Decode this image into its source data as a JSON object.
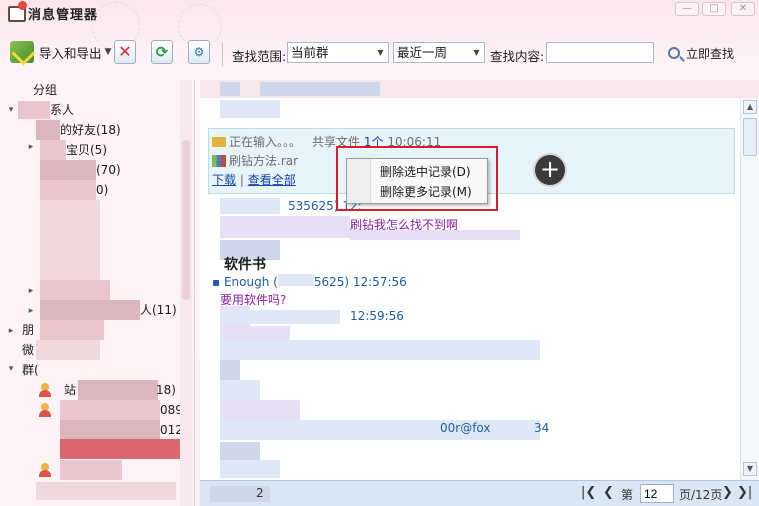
{
  "window": {
    "title": "消息管理器",
    "controls": [
      "—",
      "□",
      "✕"
    ]
  },
  "toolbar": {
    "import_export_label": "导入和导出",
    "delete_icon": "delete-x-icon",
    "refresh_icon": "refresh-icon",
    "tool_icon": "settings-tool-icon"
  },
  "search": {
    "scope_label": "查找范围:",
    "scope_value": "当前群",
    "range_value": "最近一周",
    "content_label": "查找内容:",
    "content_value": "",
    "button_label": "立即查找"
  },
  "tree": {
    "group_header": "分组",
    "contacts": "系人",
    "friends": "的好友(18)",
    "baby": "宝贝(5)",
    "c70": "(70)",
    "c0": "0)",
    "c11": "人(11)",
    "friends2": "朋",
    "weibo": "微",
    "groups": "群(",
    "g1": "站",
    "g1_count": "18)",
    "g2": "0897",
    "g3": "012"
  },
  "messages": {
    "typing": "正在输入。。。",
    "share": "共享文件",
    "share_count": "1个",
    "share_time": "10:06:11",
    "filename": "刷钻方法.rar",
    "download": "下载",
    "view_all": "查看全部",
    "sender1_id": "535625)",
    "sender1_time": "12:",
    "msg1": "刷钻我怎么找不到啊",
    "word1": "软件书",
    "sender2_name": "Enough",
    "sender2_id": "5625)",
    "sender2_time": "12:57:56",
    "msg2": "要用软件吗?",
    "sender3_time": "12:59:56",
    "email_frag": "00r@fox",
    "num_frag": "34",
    "bottom_frag": "2"
  },
  "context_menu": {
    "item1": "删除选中记录(D)",
    "item2": "删除更多记录(M)"
  },
  "pager": {
    "first": "|❮",
    "prev": "❮",
    "page_label": "第",
    "page_value": "12",
    "page_total": "页/12页",
    "next": "❯",
    "last": "❯|"
  },
  "colors": {
    "accent_red": "#d51f2a",
    "selected_row": "#dc6670",
    "msg_box": "#e7f5fb",
    "link": "#1444a8",
    "purple_text": "#8a1ea8"
  }
}
